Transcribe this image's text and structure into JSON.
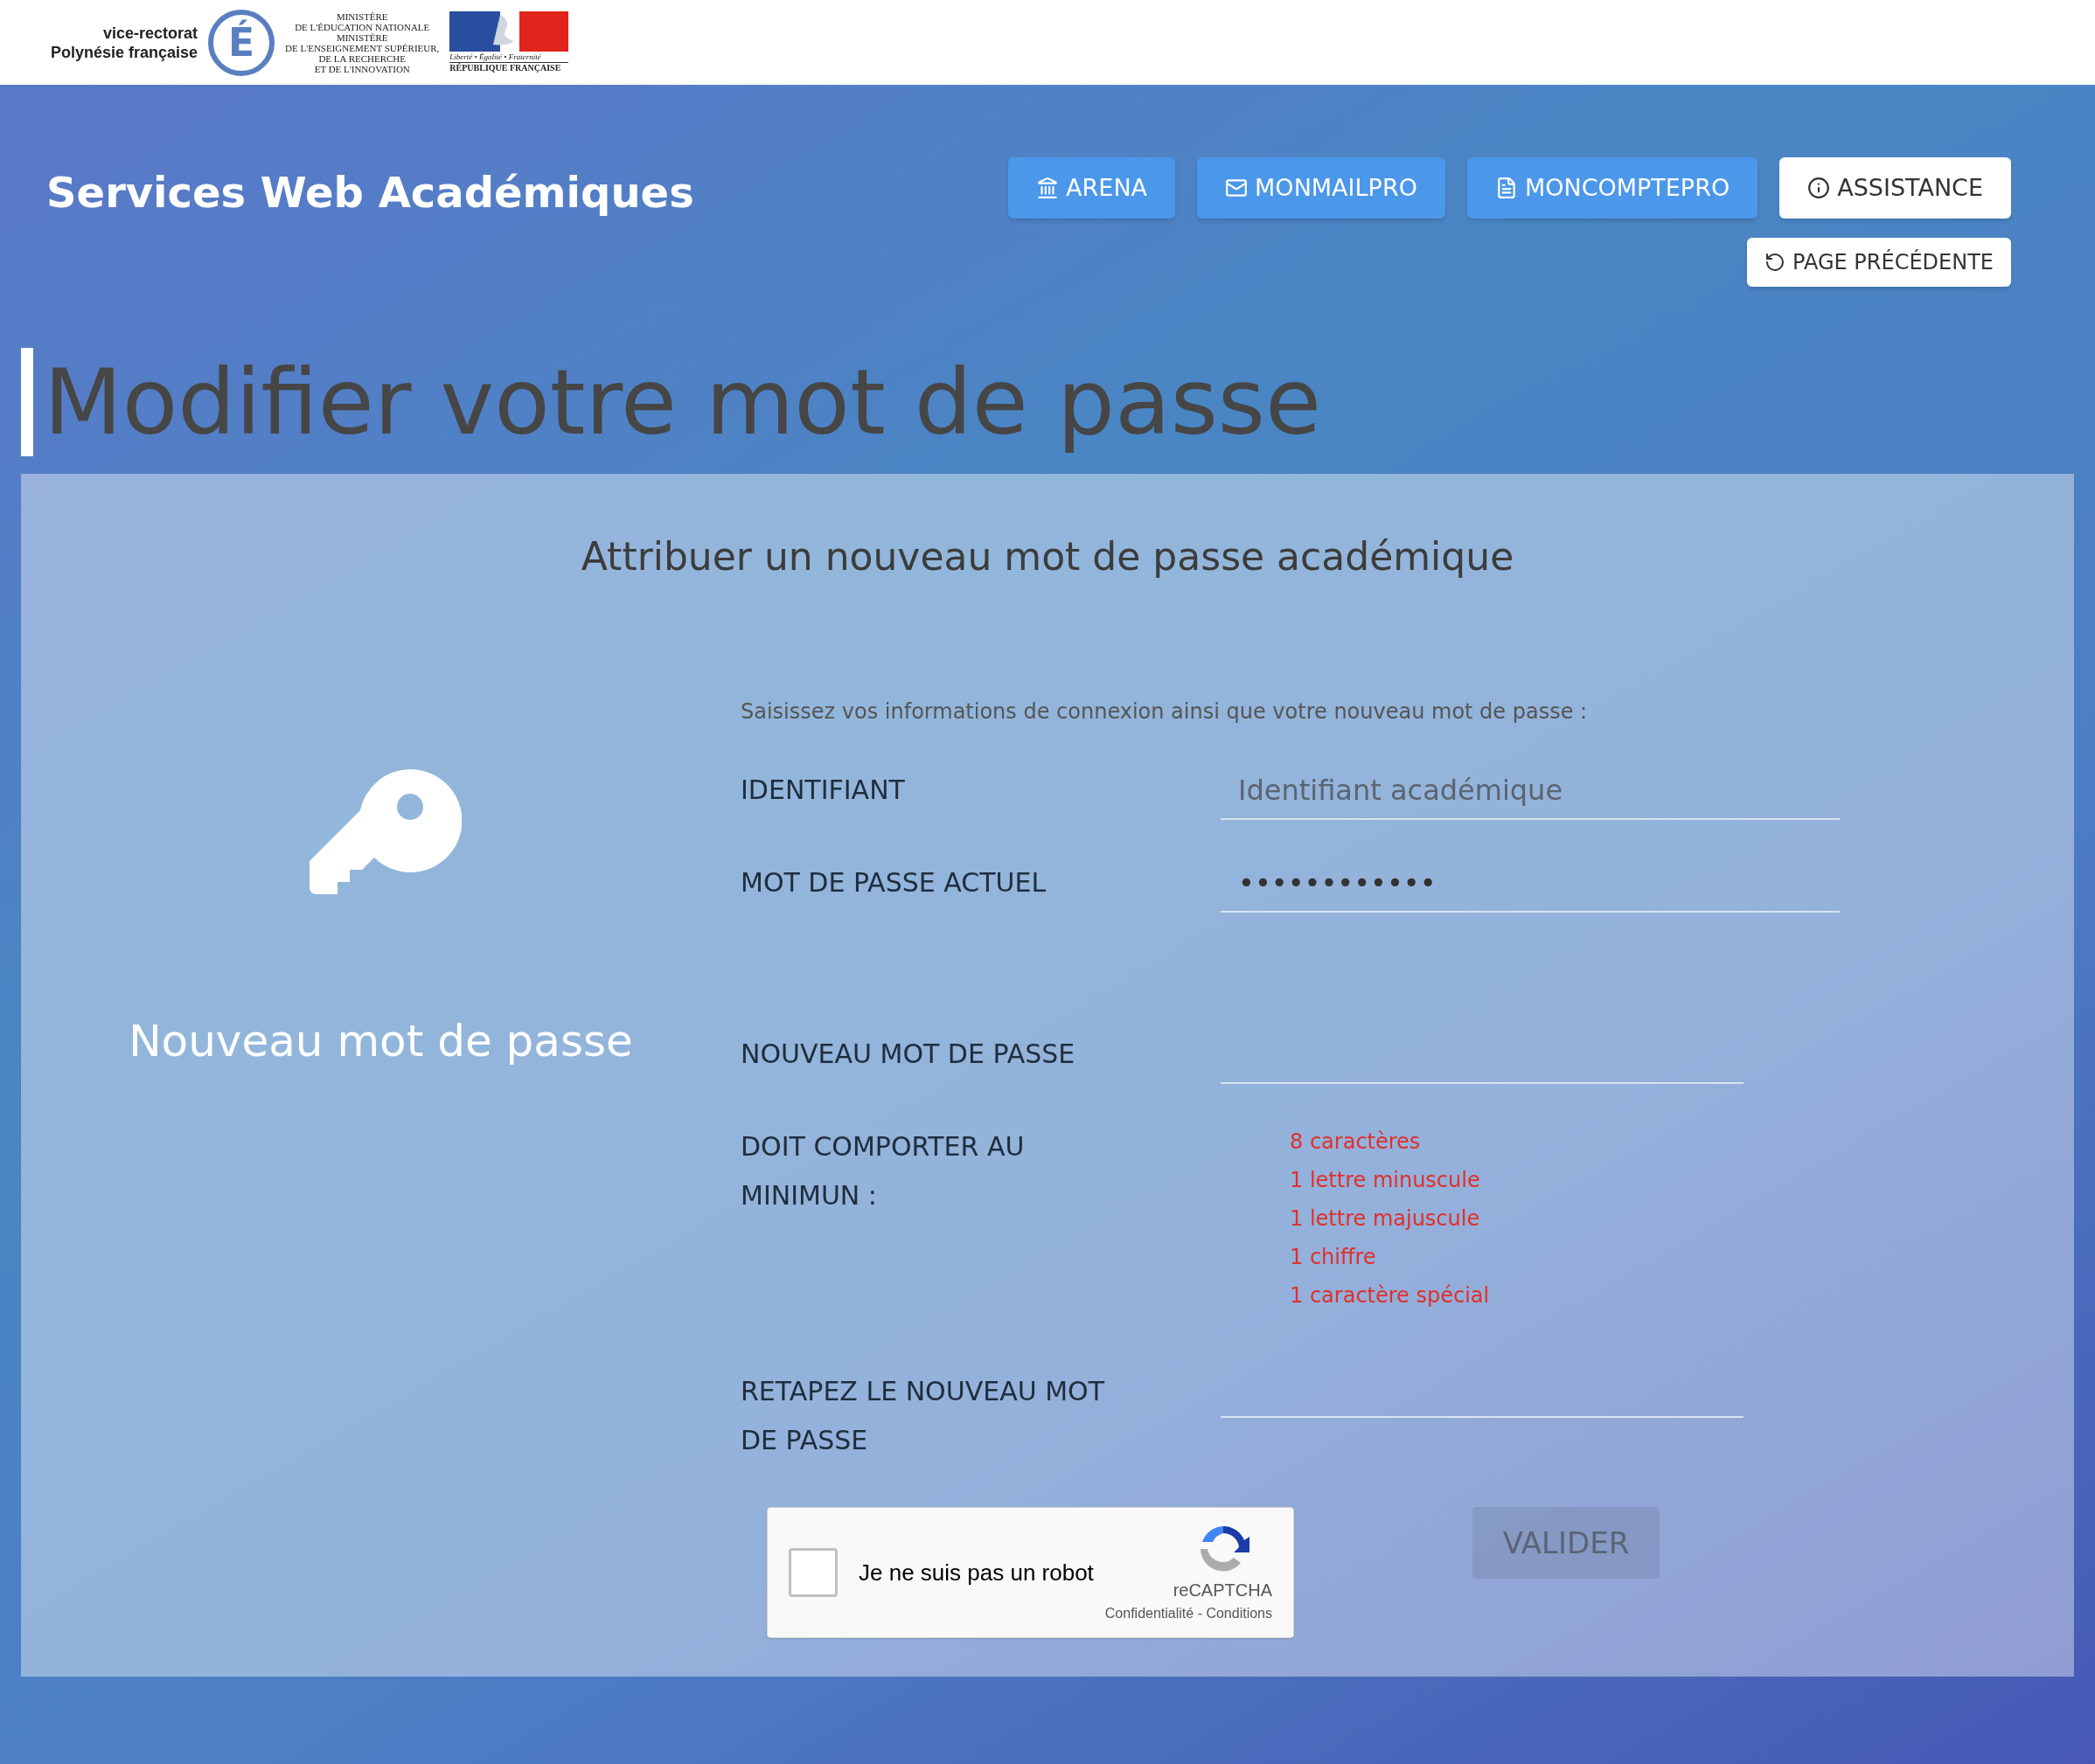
{
  "logo": {
    "rectorat_lines": [
      "vice-rectorat",
      "Polynésie française"
    ],
    "emblem_letter": "É",
    "ministry_lines": [
      "MINISTÈRE",
      "DE L'ÉDUCATION NATIONALE",
      "MINISTÈRE",
      "DE L'ENSEIGNEMENT SUPÉRIEUR,",
      "DE LA RECHERCHE",
      "ET DE L'INNOVATION"
    ],
    "motto": "Liberté • Égalité • Fraternité",
    "republic": "RÉPUBLIQUE FRANÇAISE"
  },
  "site_title": "Services Web Académiques",
  "nav_buttons": [
    {
      "label": "ARENA",
      "kind": "primary"
    },
    {
      "label": "MONMAILPRO",
      "kind": "primary"
    },
    {
      "label": "MONCOMPTEPRO",
      "kind": "primary"
    },
    {
      "label": "ASSISTANCE",
      "kind": "light"
    }
  ],
  "back_button": {
    "label": "PAGE PRÉCÉDENTE"
  },
  "page_title": "Modifier votre mot de passe",
  "card": {
    "subtitle": "Attribuer un nouveau mot de passe académique",
    "side_caption": "Nouveau mot de passe",
    "intro": "Saisissez vos informations de connexion ainsi que votre nouveau mot de passe :",
    "fields": [
      {
        "label": "IDENTIFIANT",
        "placeholder": "Identifiant académique",
        "kind": "wide"
      },
      {
        "label": "MOT DE PASSE ACTUEL",
        "value": "••••••••••••",
        "kind": "wide"
      },
      {
        "label": "NOUVEAU MOT DE PASSE",
        "kind": "narrow"
      }
    ],
    "requirements_label": "DOIT COMPORTER AU MINIMUN :",
    "requirements": [
      "8 caractères",
      "1 lettre minuscule",
      "1 lettre majuscule",
      "1 chiffre",
      "1 caractère spécial"
    ],
    "confirm_field": {
      "label": "RETAPEZ LE NOUVEAU MOT DE PASSE"
    },
    "captcha": {
      "label": "Je ne suis pas un robot",
      "checked": false,
      "brand": "reCAPTCHA",
      "links": "Confidentialité - Conditions"
    },
    "submit": {
      "label": "VALIDER",
      "disabled": true
    }
  }
}
